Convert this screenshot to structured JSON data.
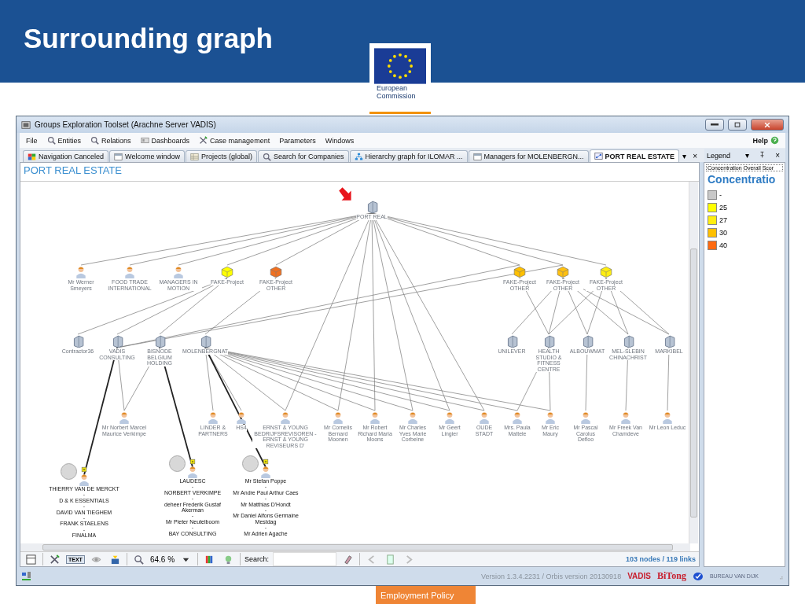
{
  "slide": {
    "title": "Surrounding graph",
    "logo_lines": [
      "European",
      "Commission"
    ],
    "footer_tag": "Employment Policy"
  },
  "window": {
    "title": "Groups Exploration Toolset (Arachne Server VADIS)"
  },
  "menu": [
    "File",
    "Entities",
    "Relations",
    "Dashboards",
    "Case management",
    "Parameters",
    "Windows"
  ],
  "help": "Help",
  "tabs": [
    {
      "label": "Navigation Canceled",
      "selected": false
    },
    {
      "label": "Welcome window",
      "selected": false
    },
    {
      "label": "Projects (global)",
      "selected": false
    },
    {
      "label": "Search for Companies",
      "selected": false
    },
    {
      "label": "Hierarchy graph for ILOMAR ...",
      "selected": false
    },
    {
      "label": "Managers for MOLENBERGN...",
      "selected": false
    },
    {
      "label": "PORT REAL ESTATE",
      "selected": true
    }
  ],
  "tab_menu": "▾",
  "tab_close": "×",
  "legend_panel": {
    "title": "Legend",
    "menu": "▾",
    "close": "×",
    "field": "Concentration Overall Scor",
    "heading": "Concentratio",
    "items": [
      {
        "label": "-",
        "color": "#c8c8c8"
      },
      {
        "label": "25",
        "color": "#ffff00"
      },
      {
        "label": "27",
        "color": "#ffee11"
      },
      {
        "label": "30",
        "color": "#ffc000"
      },
      {
        "label": "40",
        "color": "#ff6a10"
      }
    ]
  },
  "graph": {
    "heading": "PORT REAL ESTATE",
    "nodes": [
      {
        "kind": "company",
        "lines": [
          "PORT REAL"
        ],
        "expanded": false
      },
      {
        "kind": "person",
        "lines": [
          "Mr Werner Smeyers"
        ],
        "expanded": false
      },
      {
        "kind": "person",
        "lines": [
          "FOOD TRADE INTERNATIONAL"
        ],
        "expanded": false
      },
      {
        "kind": "person",
        "lines": [
          "MANAGERS IN MOTION"
        ],
        "expanded": false
      },
      {
        "kind": "project",
        "lines": [
          "FAKE-Project"
        ],
        "color": "#ffff00",
        "expanded": false
      },
      {
        "kind": "project",
        "lines": [
          "FAKE-Project OTHER"
        ],
        "color": "#f07020",
        "expanded": false
      },
      {
        "kind": "project",
        "lines": [
          "FAKE-Project OTHER"
        ],
        "color": "#ffc000",
        "expanded": false
      },
      {
        "kind": "project",
        "lines": [
          "FAKE-Project OTHER"
        ],
        "color": "#ffc010",
        "expanded": false
      },
      {
        "kind": "project",
        "lines": [
          "FAKE-Project OTHER"
        ],
        "color": "#ffee11",
        "expanded": false
      },
      {
        "kind": "company",
        "lines": [
          "Contractor36"
        ],
        "expanded": false
      },
      {
        "kind": "company",
        "lines": [
          "VADIS CONSULTING"
        ],
        "expanded": false
      },
      {
        "kind": "company",
        "lines": [
          "BISNODE BELGIUM HOLDING"
        ],
        "expanded": false
      },
      {
        "kind": "company",
        "lines": [
          "MOLENBERGNAT"
        ],
        "expanded": false
      },
      {
        "kind": "company",
        "lines": [
          "UNILEVER"
        ],
        "expanded": false
      },
      {
        "kind": "company",
        "lines": [
          "HEALTH STUDIO & FITNESS CENTRE"
        ],
        "expanded": false
      },
      {
        "kind": "company",
        "lines": [
          "ALBOUWMAT"
        ],
        "expanded": false
      },
      {
        "kind": "company",
        "lines": [
          "MEL-SLEBIN CHINACHRIST"
        ],
        "expanded": false
      },
      {
        "kind": "company",
        "lines": [
          "MARKIBEL"
        ],
        "expanded": false
      },
      {
        "kind": "person",
        "lines": [
          "Mr Norbert Marcel Maurice Verkimpe"
        ],
        "expanded": false
      },
      {
        "kind": "person",
        "lines": [
          "LINDER & PARTNERS"
        ],
        "expanded": false
      },
      {
        "kind": "person",
        "lines": [
          "HS4"
        ],
        "expanded": false
      },
      {
        "kind": "person",
        "lines": [
          "ERNST & YOUNG BEDRIJFSREVISOREN - ERNST & YOUNG REVISEURS D'"
        ],
        "expanded": false
      },
      {
        "kind": "person",
        "lines": [
          "Mr Cornelis Bernard Moonen"
        ],
        "expanded": false
      },
      {
        "kind": "person",
        "lines": [
          "Mr Robert Richard Maria Moons"
        ],
        "expanded": false
      },
      {
        "kind": "person",
        "lines": [
          "Mr Charles Yves Marie Corbeine"
        ],
        "expanded": false
      },
      {
        "kind": "person",
        "lines": [
          "Mr Geert Lingier"
        ],
        "expanded": false
      },
      {
        "kind": "person",
        "lines": [
          "OUDE STADT"
        ],
        "expanded": false
      },
      {
        "kind": "person",
        "lines": [
          "Mrs. Paula Mattele"
        ],
        "expanded": false
      },
      {
        "kind": "person",
        "lines": [
          "Mr Eric Maury"
        ],
        "expanded": false
      },
      {
        "kind": "person",
        "lines": [
          "Mr Pascal Carolus Defloo"
        ],
        "expanded": false
      },
      {
        "kind": "person",
        "lines": [
          "Mr Freek Van Chamdeve"
        ],
        "expanded": false
      },
      {
        "kind": "person",
        "lines": [
          "Mr Leon Leduc"
        ],
        "expanded": false
      },
      {
        "kind": "person",
        "lines": [
          "THIERRY VAN DE MERCKT",
          "-",
          "D & K ESSENTIALS",
          "-",
          "DAVID VAN TIEGHEM",
          "-",
          "FRANK STAELENS",
          "-",
          "FINALMA"
        ],
        "expanded": true
      },
      {
        "kind": "person",
        "lines": [
          "LAUDESC",
          "-",
          "NORBERT VERKIMPE",
          "-",
          "deheer Frederik Gustaf Akerman",
          "-",
          "Mr Pieter Neutelboom",
          "-",
          "BAY CONSULTING"
        ],
        "expanded": true
      },
      {
        "kind": "person",
        "lines": [
          "Mr Stefan Poppe",
          "-",
          "Mr Andre Paul Arthur Caes",
          "-",
          "Mr Matthias D'Hondt",
          "-",
          "Mr Daniel Alfons Germaine Mestdag",
          "-",
          "Mr Adrien Agache"
        ],
        "expanded": true
      }
    ]
  },
  "toolbar": {
    "text_toggle": {
      "label": "TEXT",
      "selected": true
    },
    "zoom": "64.6 %",
    "search_label": "Search:",
    "counts": "103 nodes / 119 links"
  },
  "status_bar": {
    "version": "Version 1.3.4.2231 / Orbis version 20130918",
    "logos": [
      "VADIS",
      "BiTong",
      "BUREAU VAN DIJK"
    ]
  }
}
